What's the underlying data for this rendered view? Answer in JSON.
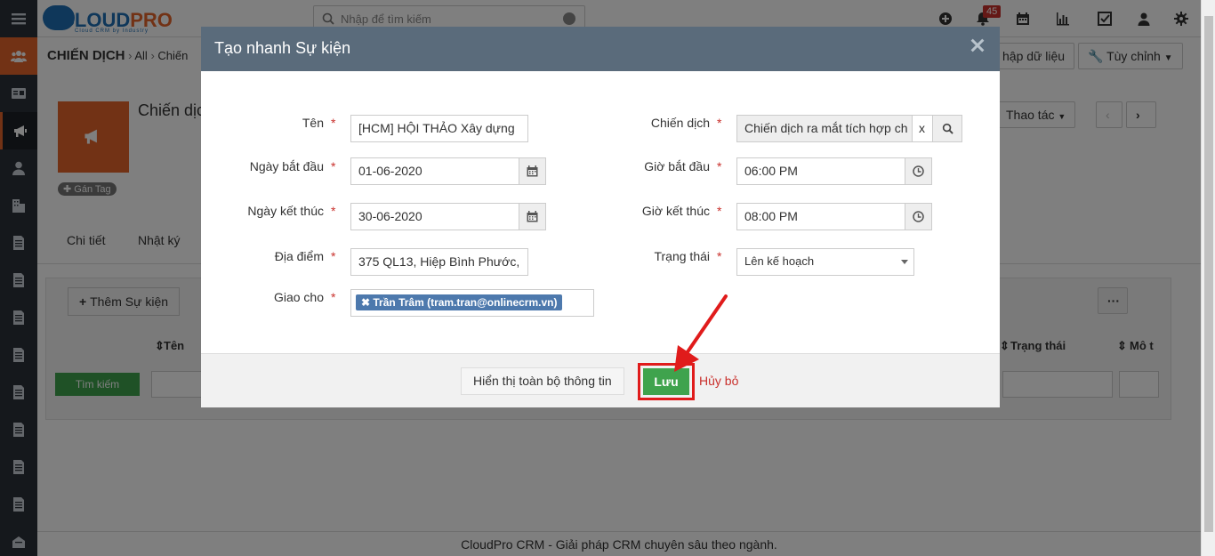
{
  "topbar": {
    "logo_primary": "CLOUD",
    "logo_accent": "PRO",
    "logo_tagline": "Cloud CRM by Industry",
    "search_placeholder": "Nhập để tìm kiếm",
    "notification_count": "45",
    "icons": [
      "plus-circle-icon",
      "bell-icon",
      "calendar-icon",
      "bar-chart-icon",
      "checkbox-icon",
      "user-icon",
      "gear-icon"
    ]
  },
  "sidebar": {
    "icons": [
      "menu-icon",
      "people-icon",
      "id-card-icon",
      "megaphone-icon",
      "user-icon",
      "building-icon",
      "document-icon",
      "document-icon",
      "document-icon",
      "document-icon",
      "document-icon",
      "document-icon",
      "document-icon",
      "document-icon",
      "document-icon",
      "inbox-icon"
    ]
  },
  "page": {
    "breadcrumb_module": "CHIẾN DỊCH",
    "breadcrumb_all": "All",
    "breadcrumb_current": "Chiến",
    "import_label": "hập dữ liệu",
    "customize_label": "Tùy chỉnh",
    "record_title": "Chiến dịc",
    "tag_label": "Gán Tag",
    "actions_label": "Thao tác",
    "tabs": [
      "Chi tiết",
      "Nhật ký"
    ],
    "add_event_label": "Thêm Sự kiện",
    "col_name": "Tên",
    "col_status": "Trạng thái",
    "col_desc": "Mô t",
    "search_button": "Tìm kiếm",
    "footer": "CloudPro CRM - Giải pháp CRM chuyên sâu theo ngành."
  },
  "modal": {
    "title": "Tạo nhanh Sự kiện",
    "fields": {
      "name_label": "Tên",
      "name_value": "[HCM] HỘI THẢO Xây dựng",
      "start_date_label": "Ngày bắt đầu",
      "start_date_value": "01-06-2020",
      "end_date_label": "Ngày kết thúc",
      "end_date_value": "30-06-2020",
      "location_label": "Địa điểm",
      "location_value": "375 QL13, Hiệp Bình Phước,",
      "assign_label": "Giao cho",
      "assign_value": "Trần Trâm (tram.tran@onlinecrm.vn)",
      "campaign_label": "Chiến dịch",
      "campaign_value": "Chiến dịch ra mắt tích hợp ch",
      "campaign_clear": "x",
      "start_time_label": "Giờ bắt đầu",
      "start_time_value": "06:00 PM",
      "end_time_label": "Giờ kết thúc",
      "end_time_value": "08:00 PM",
      "status_label": "Trạng thái",
      "status_value": "Lên kế hoạch",
      "required_mark": "*"
    },
    "buttons": {
      "full_info": "Hiển thị toàn bộ thông tin",
      "save": "Lưu",
      "cancel": "Hủy bỏ"
    },
    "highlight_color": "#e01b1b"
  }
}
